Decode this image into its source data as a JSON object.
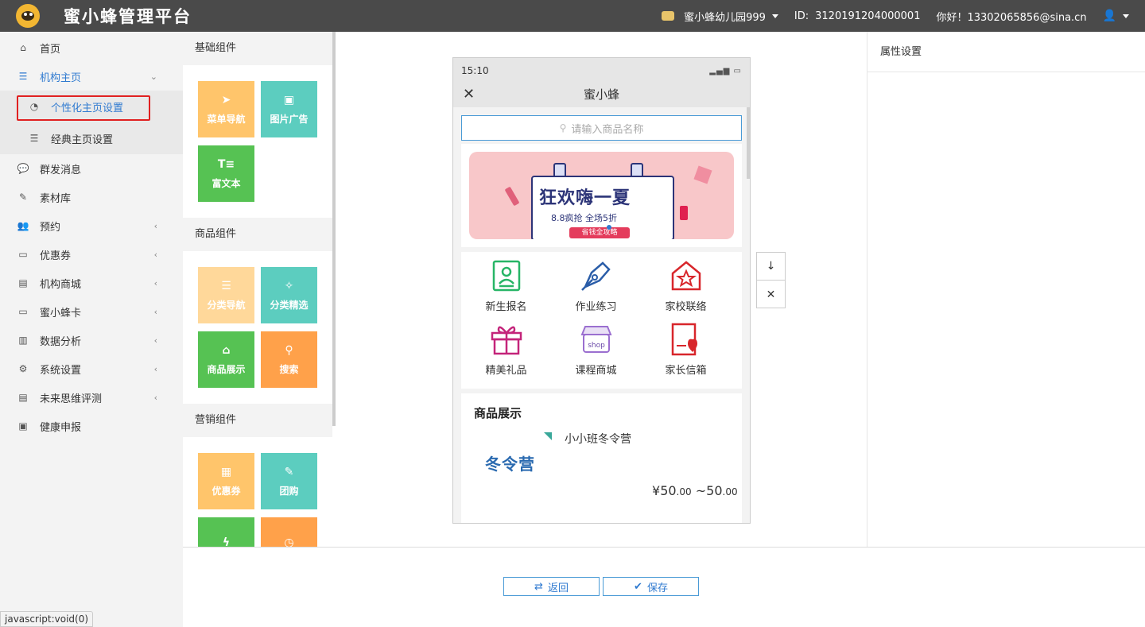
{
  "header": {
    "brand": "蜜小蜂管理平台",
    "org": "蜜小蜂幼儿园999",
    "id_label": "ID:",
    "id_value": "3120191204000001",
    "greeting": "你好！13302065856@sina.cn"
  },
  "sidebar": {
    "items": [
      {
        "label": "首页",
        "icon": "home-icon"
      },
      {
        "label": "机构主页",
        "icon": "list-icon"
      },
      {
        "label": "个性化主页设置",
        "icon": "palette-icon"
      },
      {
        "label": "经典主页设置",
        "icon": "list-icon"
      },
      {
        "label": "群发消息",
        "icon": "chat-icon"
      },
      {
        "label": "素材库",
        "icon": "edit-icon"
      },
      {
        "label": "预约",
        "icon": "users-icon"
      },
      {
        "label": "优惠券",
        "icon": "card-icon"
      },
      {
        "label": "机构商城",
        "icon": "building-icon"
      },
      {
        "label": "蜜小蜂卡",
        "icon": "card-icon"
      },
      {
        "label": "数据分析",
        "icon": "bar-chart-icon"
      },
      {
        "label": "系统设置",
        "icon": "gears-icon"
      },
      {
        "label": "未来思维评测",
        "icon": "building-icon"
      },
      {
        "label": "健康申报",
        "icon": "id-card-icon"
      }
    ],
    "status_tip": "javascript:void(0)"
  },
  "components": {
    "basic": {
      "title": "基础组件",
      "tiles": [
        "菜单导航",
        "图片广告",
        "富文本"
      ]
    },
    "goods": {
      "title": "商品组件",
      "tiles": [
        "分类导航",
        "分类精选",
        "商品展示",
        "搜索"
      ]
    },
    "marketing": {
      "title": "营销组件",
      "tiles": [
        "优惠券",
        "团购"
      ]
    }
  },
  "phone": {
    "time": "15:10",
    "title": "蜜小蜂",
    "search_placeholder": "请输入商品名称",
    "banner": {
      "headline": "狂欢嗨一夏",
      "subline": "8.8疯抢  全场5折",
      "badge": "省钱全攻略"
    },
    "menu": [
      "新生报名",
      "作业练习",
      "家校联络",
      "精美礼品",
      "课程商城",
      "家长信箱"
    ],
    "goods_title": "商品展示",
    "goods": {
      "name": "小小班冬令营",
      "image_text": "冬令营",
      "price": "¥50.00 ~50.00",
      "price_yen": "¥",
      "price_min_int": "50",
      "price_min_dec": ".00",
      "price_sep": " ~",
      "price_max_int": "50",
      "price_max_dec": ".00"
    }
  },
  "properties": {
    "title": "属性设置"
  },
  "footer": {
    "back_label": "返回",
    "save_label": "保存"
  },
  "colors": {
    "accent": "#2f7ad0",
    "header_bg": "#4a4a4a",
    "tile_orange": "#ffc56b",
    "tile_teal": "#5ccdbf",
    "tile_green": "#56c253",
    "tile_deeporange": "#ffa14a",
    "highlight_border": "#e02020"
  }
}
